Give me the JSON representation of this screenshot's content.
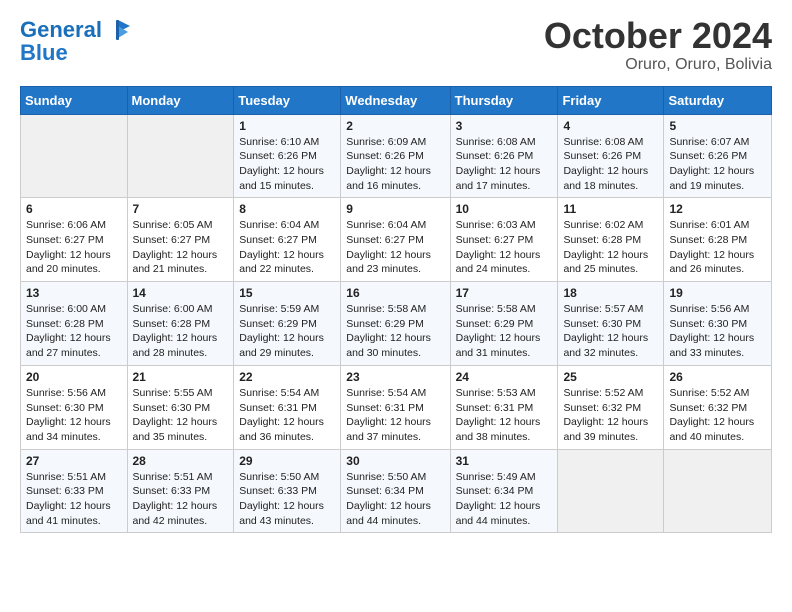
{
  "header": {
    "logo_line1": "General",
    "logo_line2": "Blue",
    "month": "October 2024",
    "location": "Oruro, Oruro, Bolivia"
  },
  "weekdays": [
    "Sunday",
    "Monday",
    "Tuesday",
    "Wednesday",
    "Thursday",
    "Friday",
    "Saturday"
  ],
  "weeks": [
    [
      {
        "day": "",
        "sunrise": "",
        "sunset": "",
        "daylight": ""
      },
      {
        "day": "",
        "sunrise": "",
        "sunset": "",
        "daylight": ""
      },
      {
        "day": "1",
        "sunrise": "Sunrise: 6:10 AM",
        "sunset": "Sunset: 6:26 PM",
        "daylight": "Daylight: 12 hours and 15 minutes."
      },
      {
        "day": "2",
        "sunrise": "Sunrise: 6:09 AM",
        "sunset": "Sunset: 6:26 PM",
        "daylight": "Daylight: 12 hours and 16 minutes."
      },
      {
        "day": "3",
        "sunrise": "Sunrise: 6:08 AM",
        "sunset": "Sunset: 6:26 PM",
        "daylight": "Daylight: 12 hours and 17 minutes."
      },
      {
        "day": "4",
        "sunrise": "Sunrise: 6:08 AM",
        "sunset": "Sunset: 6:26 PM",
        "daylight": "Daylight: 12 hours and 18 minutes."
      },
      {
        "day": "5",
        "sunrise": "Sunrise: 6:07 AM",
        "sunset": "Sunset: 6:26 PM",
        "daylight": "Daylight: 12 hours and 19 minutes."
      }
    ],
    [
      {
        "day": "6",
        "sunrise": "Sunrise: 6:06 AM",
        "sunset": "Sunset: 6:27 PM",
        "daylight": "Daylight: 12 hours and 20 minutes."
      },
      {
        "day": "7",
        "sunrise": "Sunrise: 6:05 AM",
        "sunset": "Sunset: 6:27 PM",
        "daylight": "Daylight: 12 hours and 21 minutes."
      },
      {
        "day": "8",
        "sunrise": "Sunrise: 6:04 AM",
        "sunset": "Sunset: 6:27 PM",
        "daylight": "Daylight: 12 hours and 22 minutes."
      },
      {
        "day": "9",
        "sunrise": "Sunrise: 6:04 AM",
        "sunset": "Sunset: 6:27 PM",
        "daylight": "Daylight: 12 hours and 23 minutes."
      },
      {
        "day": "10",
        "sunrise": "Sunrise: 6:03 AM",
        "sunset": "Sunset: 6:27 PM",
        "daylight": "Daylight: 12 hours and 24 minutes."
      },
      {
        "day": "11",
        "sunrise": "Sunrise: 6:02 AM",
        "sunset": "Sunset: 6:28 PM",
        "daylight": "Daylight: 12 hours and 25 minutes."
      },
      {
        "day": "12",
        "sunrise": "Sunrise: 6:01 AM",
        "sunset": "Sunset: 6:28 PM",
        "daylight": "Daylight: 12 hours and 26 minutes."
      }
    ],
    [
      {
        "day": "13",
        "sunrise": "Sunrise: 6:00 AM",
        "sunset": "Sunset: 6:28 PM",
        "daylight": "Daylight: 12 hours and 27 minutes."
      },
      {
        "day": "14",
        "sunrise": "Sunrise: 6:00 AM",
        "sunset": "Sunset: 6:28 PM",
        "daylight": "Daylight: 12 hours and 28 minutes."
      },
      {
        "day": "15",
        "sunrise": "Sunrise: 5:59 AM",
        "sunset": "Sunset: 6:29 PM",
        "daylight": "Daylight: 12 hours and 29 minutes."
      },
      {
        "day": "16",
        "sunrise": "Sunrise: 5:58 AM",
        "sunset": "Sunset: 6:29 PM",
        "daylight": "Daylight: 12 hours and 30 minutes."
      },
      {
        "day": "17",
        "sunrise": "Sunrise: 5:58 AM",
        "sunset": "Sunset: 6:29 PM",
        "daylight": "Daylight: 12 hours and 31 minutes."
      },
      {
        "day": "18",
        "sunrise": "Sunrise: 5:57 AM",
        "sunset": "Sunset: 6:30 PM",
        "daylight": "Daylight: 12 hours and 32 minutes."
      },
      {
        "day": "19",
        "sunrise": "Sunrise: 5:56 AM",
        "sunset": "Sunset: 6:30 PM",
        "daylight": "Daylight: 12 hours and 33 minutes."
      }
    ],
    [
      {
        "day": "20",
        "sunrise": "Sunrise: 5:56 AM",
        "sunset": "Sunset: 6:30 PM",
        "daylight": "Daylight: 12 hours and 34 minutes."
      },
      {
        "day": "21",
        "sunrise": "Sunrise: 5:55 AM",
        "sunset": "Sunset: 6:30 PM",
        "daylight": "Daylight: 12 hours and 35 minutes."
      },
      {
        "day": "22",
        "sunrise": "Sunrise: 5:54 AM",
        "sunset": "Sunset: 6:31 PM",
        "daylight": "Daylight: 12 hours and 36 minutes."
      },
      {
        "day": "23",
        "sunrise": "Sunrise: 5:54 AM",
        "sunset": "Sunset: 6:31 PM",
        "daylight": "Daylight: 12 hours and 37 minutes."
      },
      {
        "day": "24",
        "sunrise": "Sunrise: 5:53 AM",
        "sunset": "Sunset: 6:31 PM",
        "daylight": "Daylight: 12 hours and 38 minutes."
      },
      {
        "day": "25",
        "sunrise": "Sunrise: 5:52 AM",
        "sunset": "Sunset: 6:32 PM",
        "daylight": "Daylight: 12 hours and 39 minutes."
      },
      {
        "day": "26",
        "sunrise": "Sunrise: 5:52 AM",
        "sunset": "Sunset: 6:32 PM",
        "daylight": "Daylight: 12 hours and 40 minutes."
      }
    ],
    [
      {
        "day": "27",
        "sunrise": "Sunrise: 5:51 AM",
        "sunset": "Sunset: 6:33 PM",
        "daylight": "Daylight: 12 hours and 41 minutes."
      },
      {
        "day": "28",
        "sunrise": "Sunrise: 5:51 AM",
        "sunset": "Sunset: 6:33 PM",
        "daylight": "Daylight: 12 hours and 42 minutes."
      },
      {
        "day": "29",
        "sunrise": "Sunrise: 5:50 AM",
        "sunset": "Sunset: 6:33 PM",
        "daylight": "Daylight: 12 hours and 43 minutes."
      },
      {
        "day": "30",
        "sunrise": "Sunrise: 5:50 AM",
        "sunset": "Sunset: 6:34 PM",
        "daylight": "Daylight: 12 hours and 44 minutes."
      },
      {
        "day": "31",
        "sunrise": "Sunrise: 5:49 AM",
        "sunset": "Sunset: 6:34 PM",
        "daylight": "Daylight: 12 hours and 44 minutes."
      },
      {
        "day": "",
        "sunrise": "",
        "sunset": "",
        "daylight": ""
      },
      {
        "day": "",
        "sunrise": "",
        "sunset": "",
        "daylight": ""
      }
    ]
  ]
}
